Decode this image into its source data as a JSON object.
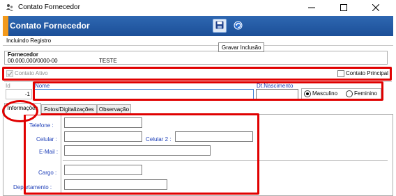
{
  "window": {
    "title": "Contato Fornecedor",
    "controls": {
      "minimize": "–",
      "maximize": "☐",
      "close": "✕"
    }
  },
  "header": {
    "title": "Contato Fornecedor",
    "toolbar": {
      "save_icon": "save-disk-icon",
      "undo_icon": "undo-icon"
    },
    "tooltip": "Gravar Inclusão",
    "accent_color": "#f39a1c",
    "band_color": "#1c4f98"
  },
  "status": {
    "text": "Incluindo Registro"
  },
  "fornecedor": {
    "label": "Fornecedor",
    "code": "00.000.000/0000-00",
    "name": "TESTE"
  },
  "flags": {
    "contato_ativo": {
      "label": "Contato Ativo",
      "checked": true,
      "enabled": false
    },
    "contato_principal": {
      "label": "Contato Principal",
      "checked": false
    }
  },
  "contact": {
    "id_label": "Id",
    "id_value": "-1",
    "nome_label": "Nome",
    "nome_value": "",
    "nascimento_label": "Dt.Nascimento",
    "nascimento_value": "",
    "gender": {
      "options": [
        "Masculino",
        "Feminino"
      ],
      "selected": "Masculino"
    }
  },
  "tabs": [
    {
      "label": "Informações",
      "active": true
    },
    {
      "label": "Fotos/Digitalizações",
      "active": false
    },
    {
      "label": "Observação",
      "active": false
    }
  ],
  "info": {
    "telefone_label": "Telefone :",
    "celular_label": "Celular :",
    "celular2_label": "Celular 2 :",
    "email_label": "E-Mail :",
    "cargo_label": "Cargo :",
    "departamento_label": "Departamento :",
    "telefone": "",
    "celular": "",
    "celular2": "",
    "email": "",
    "cargo": "",
    "departamento": ""
  },
  "annotation_color": "#e00000"
}
